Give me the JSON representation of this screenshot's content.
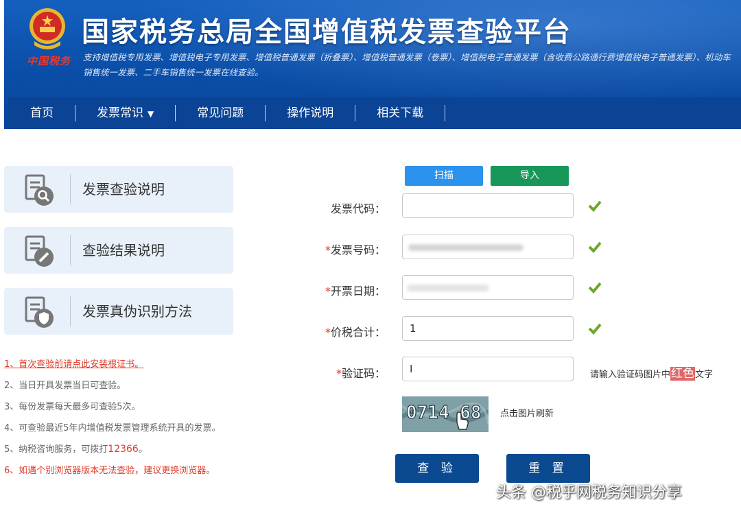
{
  "header": {
    "brand_script": "中国税务",
    "title": "国家税务总局全国增值税发票查验平台",
    "subtitle": "支持增值税专用发票、增值税电子专用发票、增值税普通发票（折叠票）、增值税普通发票（卷票）、增值税电子普通发票（含收费公路通行费增值税电子普通发票）、机动车销售统一发票、二手车销售统一发票在线查验。"
  },
  "nav": {
    "items": [
      {
        "label": "首页"
      },
      {
        "label": "发票常识"
      },
      {
        "label": "常见问题"
      },
      {
        "label": "操作说明"
      },
      {
        "label": "相关下载"
      }
    ],
    "dropdown_icon": "chevron-down-icon"
  },
  "sidebar": {
    "cards": [
      {
        "label": "发票查验说明",
        "icon": "document-search-icon"
      },
      {
        "label": "查验结果说明",
        "icon": "document-edit-icon"
      },
      {
        "label": "发票真伪识别方法",
        "icon": "document-shield-icon"
      }
    ]
  },
  "notes": {
    "n1": "1、首次查验前请点此安装根证书。",
    "n2": "2、当日开具发票当日可查验。",
    "n3": "3、每份发票每天最多可查验5次。",
    "n4": "4、可查验最近5年内增值税发票管理系统开具的发票。",
    "n5_prefix": "5、纳税咨询服务，可拨打",
    "n5_phone": "12366",
    "n5_suffix": "。",
    "n6": "6、如遇个别浏览器版本无法查验，建议更换浏览器。"
  },
  "form": {
    "scan_label": "扫描",
    "import_label": "导入",
    "code_label": "发票代码：",
    "number_label": "发票号码：",
    "date_label": "开票日期：",
    "total_label": "价税合计：",
    "captcha_label": "验证码：",
    "required_mark": "*",
    "code_value": "",
    "total_value": "1",
    "captcha_value": "I",
    "captcha_hint_prefix": "请输入验证码图片中",
    "captcha_hint_color": "红色",
    "captcha_hint_suffix": "文字",
    "captcha_image_text": "0714 68",
    "refresh_hint": "点击图片刷新",
    "check_label": "查 验",
    "reset_label": "重 置"
  },
  "watermark": "头条 @税乎网税务知识分享",
  "colors": {
    "header_blue": "#0a4ea8",
    "nav_blue": "#0b4395",
    "scan_blue": "#2b92ee",
    "import_green": "#17985a",
    "check_green": "#6aa82a",
    "button_navy": "#0b4a91",
    "red": "#e03a2a"
  }
}
